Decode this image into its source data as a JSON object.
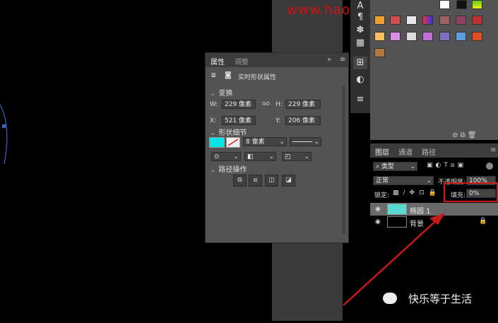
{
  "watermark": "www.hao...[obscured]",
  "properties": {
    "tabs": [
      "属性",
      "调整"
    ],
    "shape_title": "实时形状属性",
    "section_transform": "变换",
    "w_label": "W:",
    "w_value": "229 像素",
    "link_label": "GO",
    "h_label": "H:",
    "h_value": "229 像素",
    "x_label": "X:",
    "x_value": "521 像素",
    "y_label": "Y:",
    "y_value": "206 像素",
    "section_shape": "形状细节",
    "stroke_size": "8 像素",
    "section_path": "路径操作"
  },
  "layers": {
    "tabs": [
      "图层",
      "通道",
      "路径"
    ],
    "filter_kind": "类型",
    "blend_mode": "正常",
    "opacity_label": "不透明度:",
    "opacity_value": "100%",
    "lock_label": "锁定:",
    "fill_label": "填充:",
    "fill_value": "0%",
    "items": [
      {
        "name": "椭圆 1",
        "thumb": "#55d9d2",
        "selected": true
      },
      {
        "name": "背景",
        "thumb": "#000000",
        "selected": false
      }
    ]
  },
  "brand_text": "快乐等于生活",
  "colors": {
    "accent_red": "#d01818",
    "fill_cyan": "#00e5e5",
    "panel_bg": "#535353",
    "header_bg": "#3c3c3c"
  }
}
